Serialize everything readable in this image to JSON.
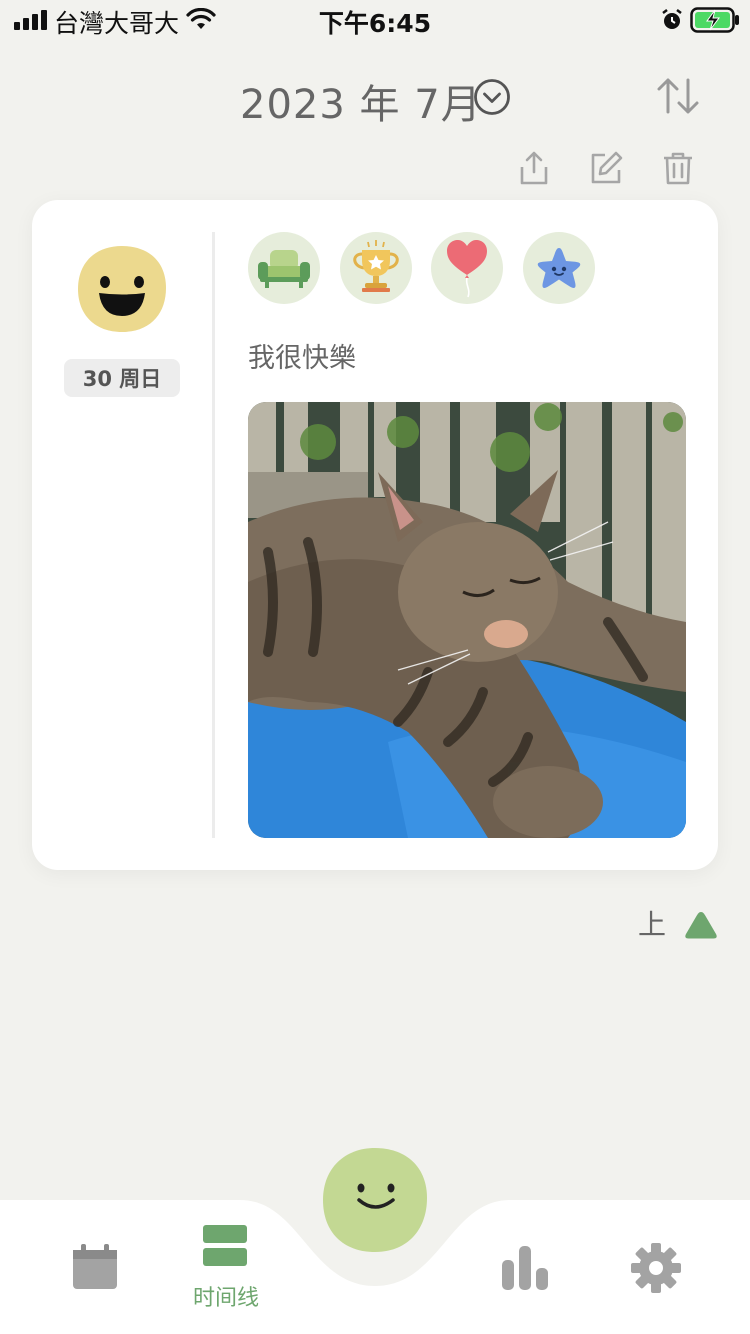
{
  "status_bar": {
    "carrier": "台灣大哥大",
    "time": "下午6:45"
  },
  "header": {
    "month": "2023 年 7月"
  },
  "entry": {
    "day_label": "30 周日",
    "note": "我很快樂",
    "mood": "happy-face",
    "activities": [
      "couch-icon",
      "trophy-icon",
      "balloon-icon",
      "star-icon"
    ],
    "photo": "sleeping tabby cat"
  },
  "top_link": {
    "label": "上"
  },
  "tabbar": {
    "items": [
      {
        "icon": "calendar-icon"
      },
      {
        "icon": "timeline-icon",
        "label": "时间线",
        "active": true
      },
      {
        "icon": "add-mood-icon"
      },
      {
        "icon": "stats-icon"
      },
      {
        "icon": "settings-icon"
      }
    ]
  },
  "colors": {
    "background": "#f2f2ee",
    "accent_green": "#6ea66e",
    "mood_yellow": "#ecd98e",
    "fab_green": "#c3d893"
  }
}
